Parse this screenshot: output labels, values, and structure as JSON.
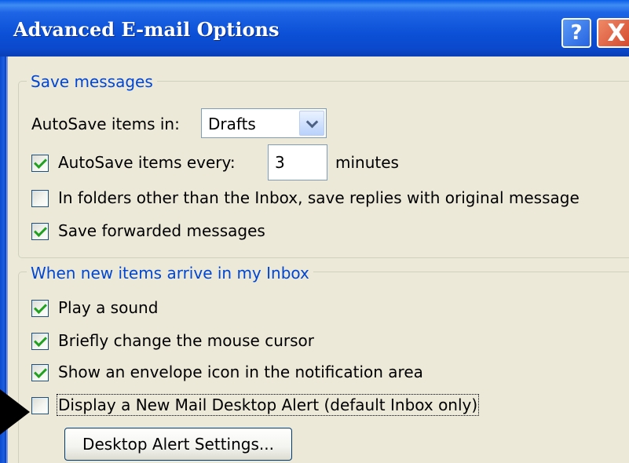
{
  "window": {
    "title": "Advanced E-mail Options",
    "help_label": "?",
    "close_label": "X"
  },
  "save_messages": {
    "legend": "Save messages",
    "autosave_in_label": "AutoSave items in:",
    "autosave_in_value": "Drafts",
    "autosave_every": {
      "label": "AutoSave items every:",
      "checked": true,
      "value": "3",
      "unit": "minutes"
    },
    "save_replies": {
      "label": "In folders other than the Inbox, save replies with original message",
      "checked": false
    },
    "save_forwarded": {
      "label": "Save forwarded messages",
      "checked": true
    }
  },
  "new_items": {
    "legend": "When new items arrive in my Inbox",
    "play_sound": {
      "label": "Play a sound",
      "checked": true
    },
    "change_cursor": {
      "label": "Briefly change the mouse cursor",
      "checked": true
    },
    "envelope_icon": {
      "label": "Show an envelope icon in the notification area",
      "checked": true
    },
    "desktop_alert": {
      "label": "Display a New Mail Desktop Alert (default Inbox only)",
      "checked": false
    },
    "alert_settings_button": "Desktop Alert Settings..."
  },
  "colors": {
    "titlebar": "#0b50d6",
    "legend_text": "#0046d5",
    "dialog_bg": "#ece9d8",
    "check_mark": "#21a121"
  }
}
